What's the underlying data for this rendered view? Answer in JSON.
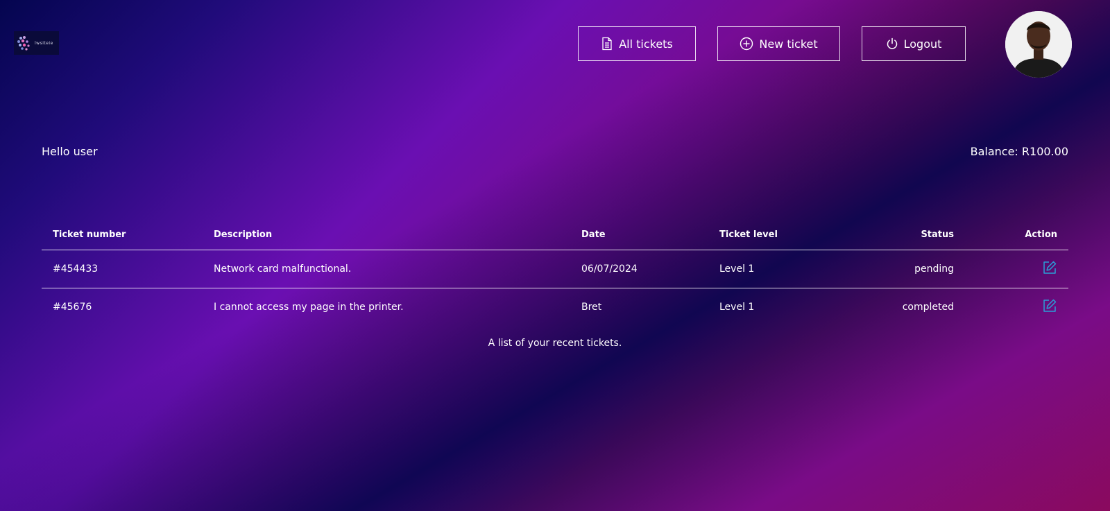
{
  "header": {
    "logo_text": "lwsiteie",
    "nav": {
      "all_tickets": "All tickets",
      "new_ticket": "New ticket",
      "logout": "Logout"
    }
  },
  "greeting": "Hello user",
  "balance": "Balance: R100.00",
  "table": {
    "columns": {
      "ticket_number": "Ticket number",
      "description": "Description",
      "date": "Date",
      "ticket_level": "Ticket level",
      "status": "Status",
      "action": "Action"
    },
    "rows": [
      {
        "ticket_number": "#454433",
        "description": "Network card malfunctional.",
        "date": "06/07/2024",
        "ticket_level": "Level 1",
        "status": "pending"
      },
      {
        "ticket_number": "#45676",
        "description": "I cannot access my page in the printer.",
        "date": "Bret",
        "ticket_level": "Level 1",
        "status": "completed"
      }
    ],
    "caption": "A list of your recent tickets."
  },
  "icons": {
    "all_tickets": "document-icon",
    "new_ticket": "plus-circle-icon",
    "logout": "power-icon",
    "action": "edit-icon"
  },
  "colors": {
    "edit_icon": "#2a9fd8",
    "gradient_dark": "#04054f",
    "gradient_purple": "#6a0fb2",
    "gradient_magenta": "#880a5a"
  }
}
